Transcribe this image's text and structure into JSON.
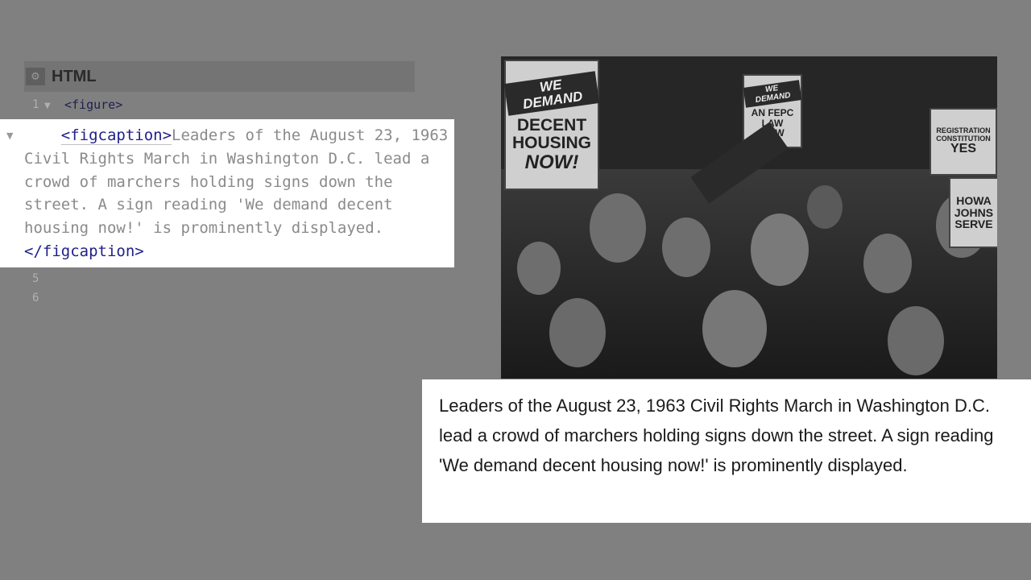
{
  "editor": {
    "panel_title": "HTML",
    "gear_icon": "gear-icon",
    "lines": [
      {
        "num": "1",
        "text": "<figure>"
      },
      {
        "num": "5",
        "text": ""
      },
      {
        "num": "6",
        "text": ""
      }
    ],
    "highlight": {
      "open_tag": "<figcaption>",
      "text_first": "Leaders of the August 23, 1963",
      "text_rest": "Civil Rights March in Washington D.C. lead a\ncrowd of marchers holding signs down the\nstreet. A sign reading 'We demand decent\nhousing now!' is prominently displayed.",
      "close_tag": "</figcaption>"
    }
  },
  "photo": {
    "sign_main": {
      "top": "WE DEMAND",
      "line1": "DECENT",
      "line2": "HOUSING",
      "line3": "NOW!"
    },
    "sign_fepc": {
      "top": "WE DEMAND",
      "line1": "AN FEPC",
      "line2": "LAW",
      "line3": "NOW"
    },
    "sign_right": {
      "line1": "REGISTRATION",
      "line2": "CONSTITUTION",
      "line3": "YES"
    },
    "sign_howard": {
      "line1": "HOWA",
      "line2": "JOHNS",
      "line3": "SERVE"
    }
  },
  "caption": {
    "text": "Leaders of the August 23, 1963 Civil Rights March in Washington D.C. lead a crowd of marchers holding signs down the street. A sign reading 'We demand decent housing now!' is prominently displayed."
  }
}
